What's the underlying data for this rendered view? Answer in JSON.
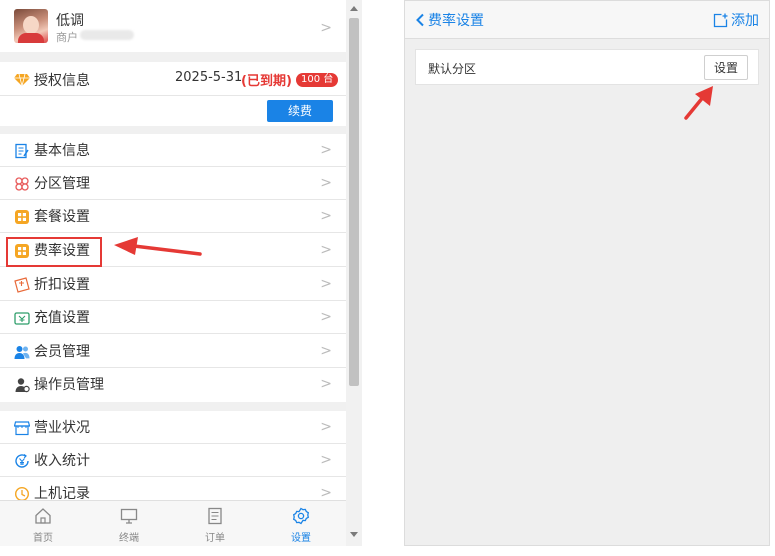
{
  "left": {
    "profile": {
      "name": "低调",
      "sub": "商户"
    },
    "license": {
      "title": "授权信息",
      "date": "2025-5-31",
      "status": "(已到期)",
      "badge": "100 台",
      "renew_label": "续费"
    },
    "menu_group1": [
      {
        "label": "基本信息",
        "icon": "document-edit-icon"
      },
      {
        "label": "分区管理",
        "icon": "clover-icon"
      },
      {
        "label": "套餐设置",
        "icon": "grid-icon"
      },
      {
        "label": "费率设置",
        "icon": "grid-icon"
      },
      {
        "label": "折扣设置",
        "icon": "ticket-icon"
      },
      {
        "label": "充值设置",
        "icon": "wallet-icon"
      },
      {
        "label": "会员管理",
        "icon": "users-icon"
      },
      {
        "label": "操作员管理",
        "icon": "user-gear-icon"
      }
    ],
    "menu_group2": [
      {
        "label": "营业状况",
        "icon": "store-icon"
      },
      {
        "label": "收入统计",
        "icon": "income-icon"
      },
      {
        "label": "上机记录",
        "icon": "history-icon"
      }
    ],
    "chevron": ">",
    "tabs": [
      {
        "label": "首页",
        "icon": "home-icon"
      },
      {
        "label": "终端",
        "icon": "monitor-icon"
      },
      {
        "label": "订单",
        "icon": "order-icon"
      },
      {
        "label": "设置",
        "icon": "settings-icon",
        "active": true
      }
    ]
  },
  "right": {
    "header": {
      "back_label": "费率设置",
      "add_label": "添加"
    },
    "zone": {
      "label": "默认分区",
      "button_label": "设置"
    }
  },
  "colors": {
    "accent": "#1a83e6",
    "badge": "#e53935",
    "annotation": "#e53935",
    "orange_icon": "#f5a623"
  }
}
